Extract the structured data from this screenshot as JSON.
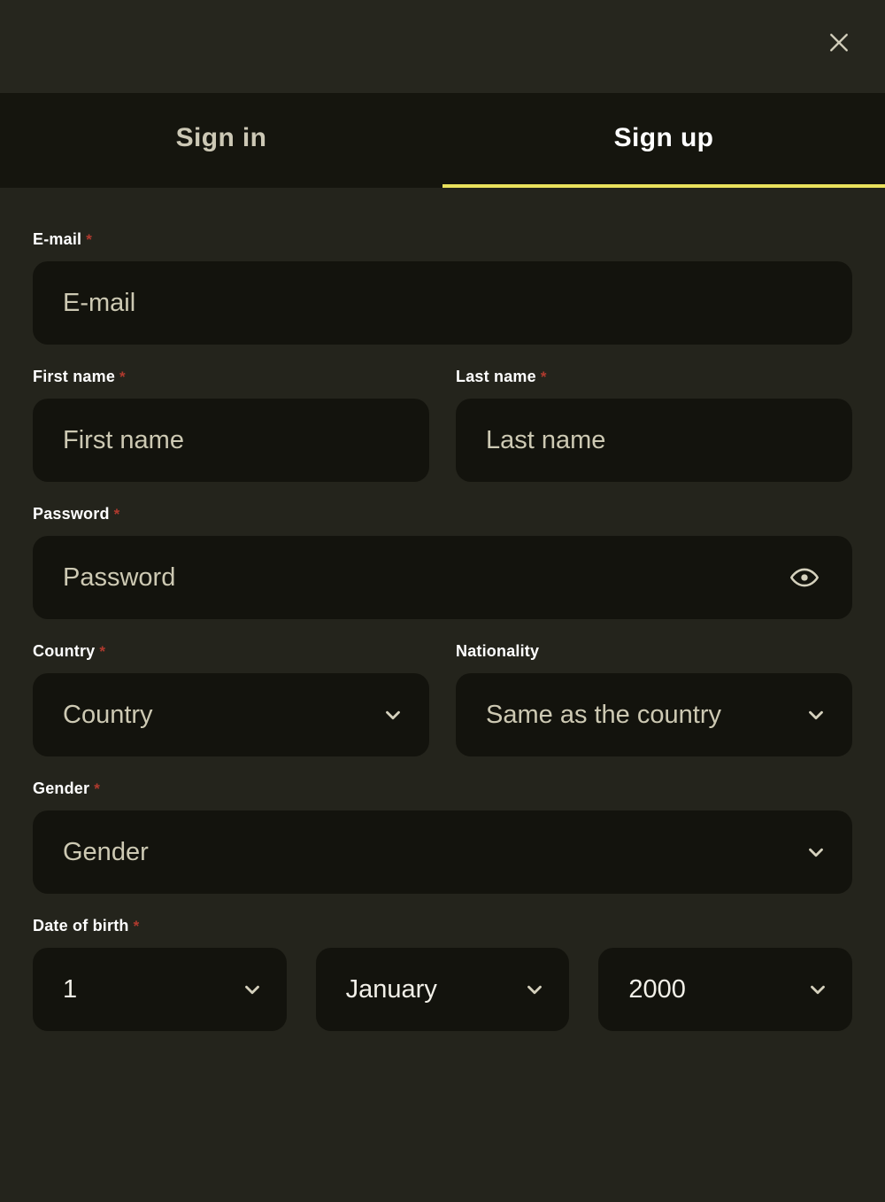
{
  "header": {
    "close_icon": "close-icon",
    "close_label": "Close"
  },
  "tabs": [
    {
      "label": "Sign in",
      "active": false
    },
    {
      "label": "Sign up",
      "active": true
    }
  ],
  "colors": {
    "accent": "#e9e15c",
    "required": "#b03a2e",
    "placeholder": "#cdc9b3",
    "input_bg": "#13130d",
    "body_bg": "#24241c",
    "header_bg": "#26261e",
    "tabbar_bg": "#15150e"
  },
  "form": {
    "email": {
      "label": "E-mail",
      "required": "*",
      "placeholder": "E-mail",
      "value": ""
    },
    "first_name": {
      "label": "First name",
      "required": "*",
      "placeholder": "First name",
      "value": ""
    },
    "last_name": {
      "label": "Last name",
      "required": "*",
      "placeholder": "Last name",
      "value": ""
    },
    "password": {
      "label": "Password",
      "required": "*",
      "placeholder": "Password",
      "value": "",
      "toggle_icon": "eye-icon"
    },
    "country": {
      "label": "Country",
      "required": "*",
      "selected": "Country",
      "chevron_icon": "chevron-down-icon"
    },
    "nationality": {
      "label": "Nationality",
      "required": "",
      "selected": "Same as the country",
      "chevron_icon": "chevron-down-icon"
    },
    "gender": {
      "label": "Gender",
      "required": "*",
      "selected": "Gender",
      "chevron_icon": "chevron-down-icon"
    },
    "date_of_birth": {
      "label": "Date of birth",
      "required": "*",
      "day": "1",
      "month": "January",
      "year": "2000",
      "chevron_icon": "chevron-down-icon"
    }
  }
}
